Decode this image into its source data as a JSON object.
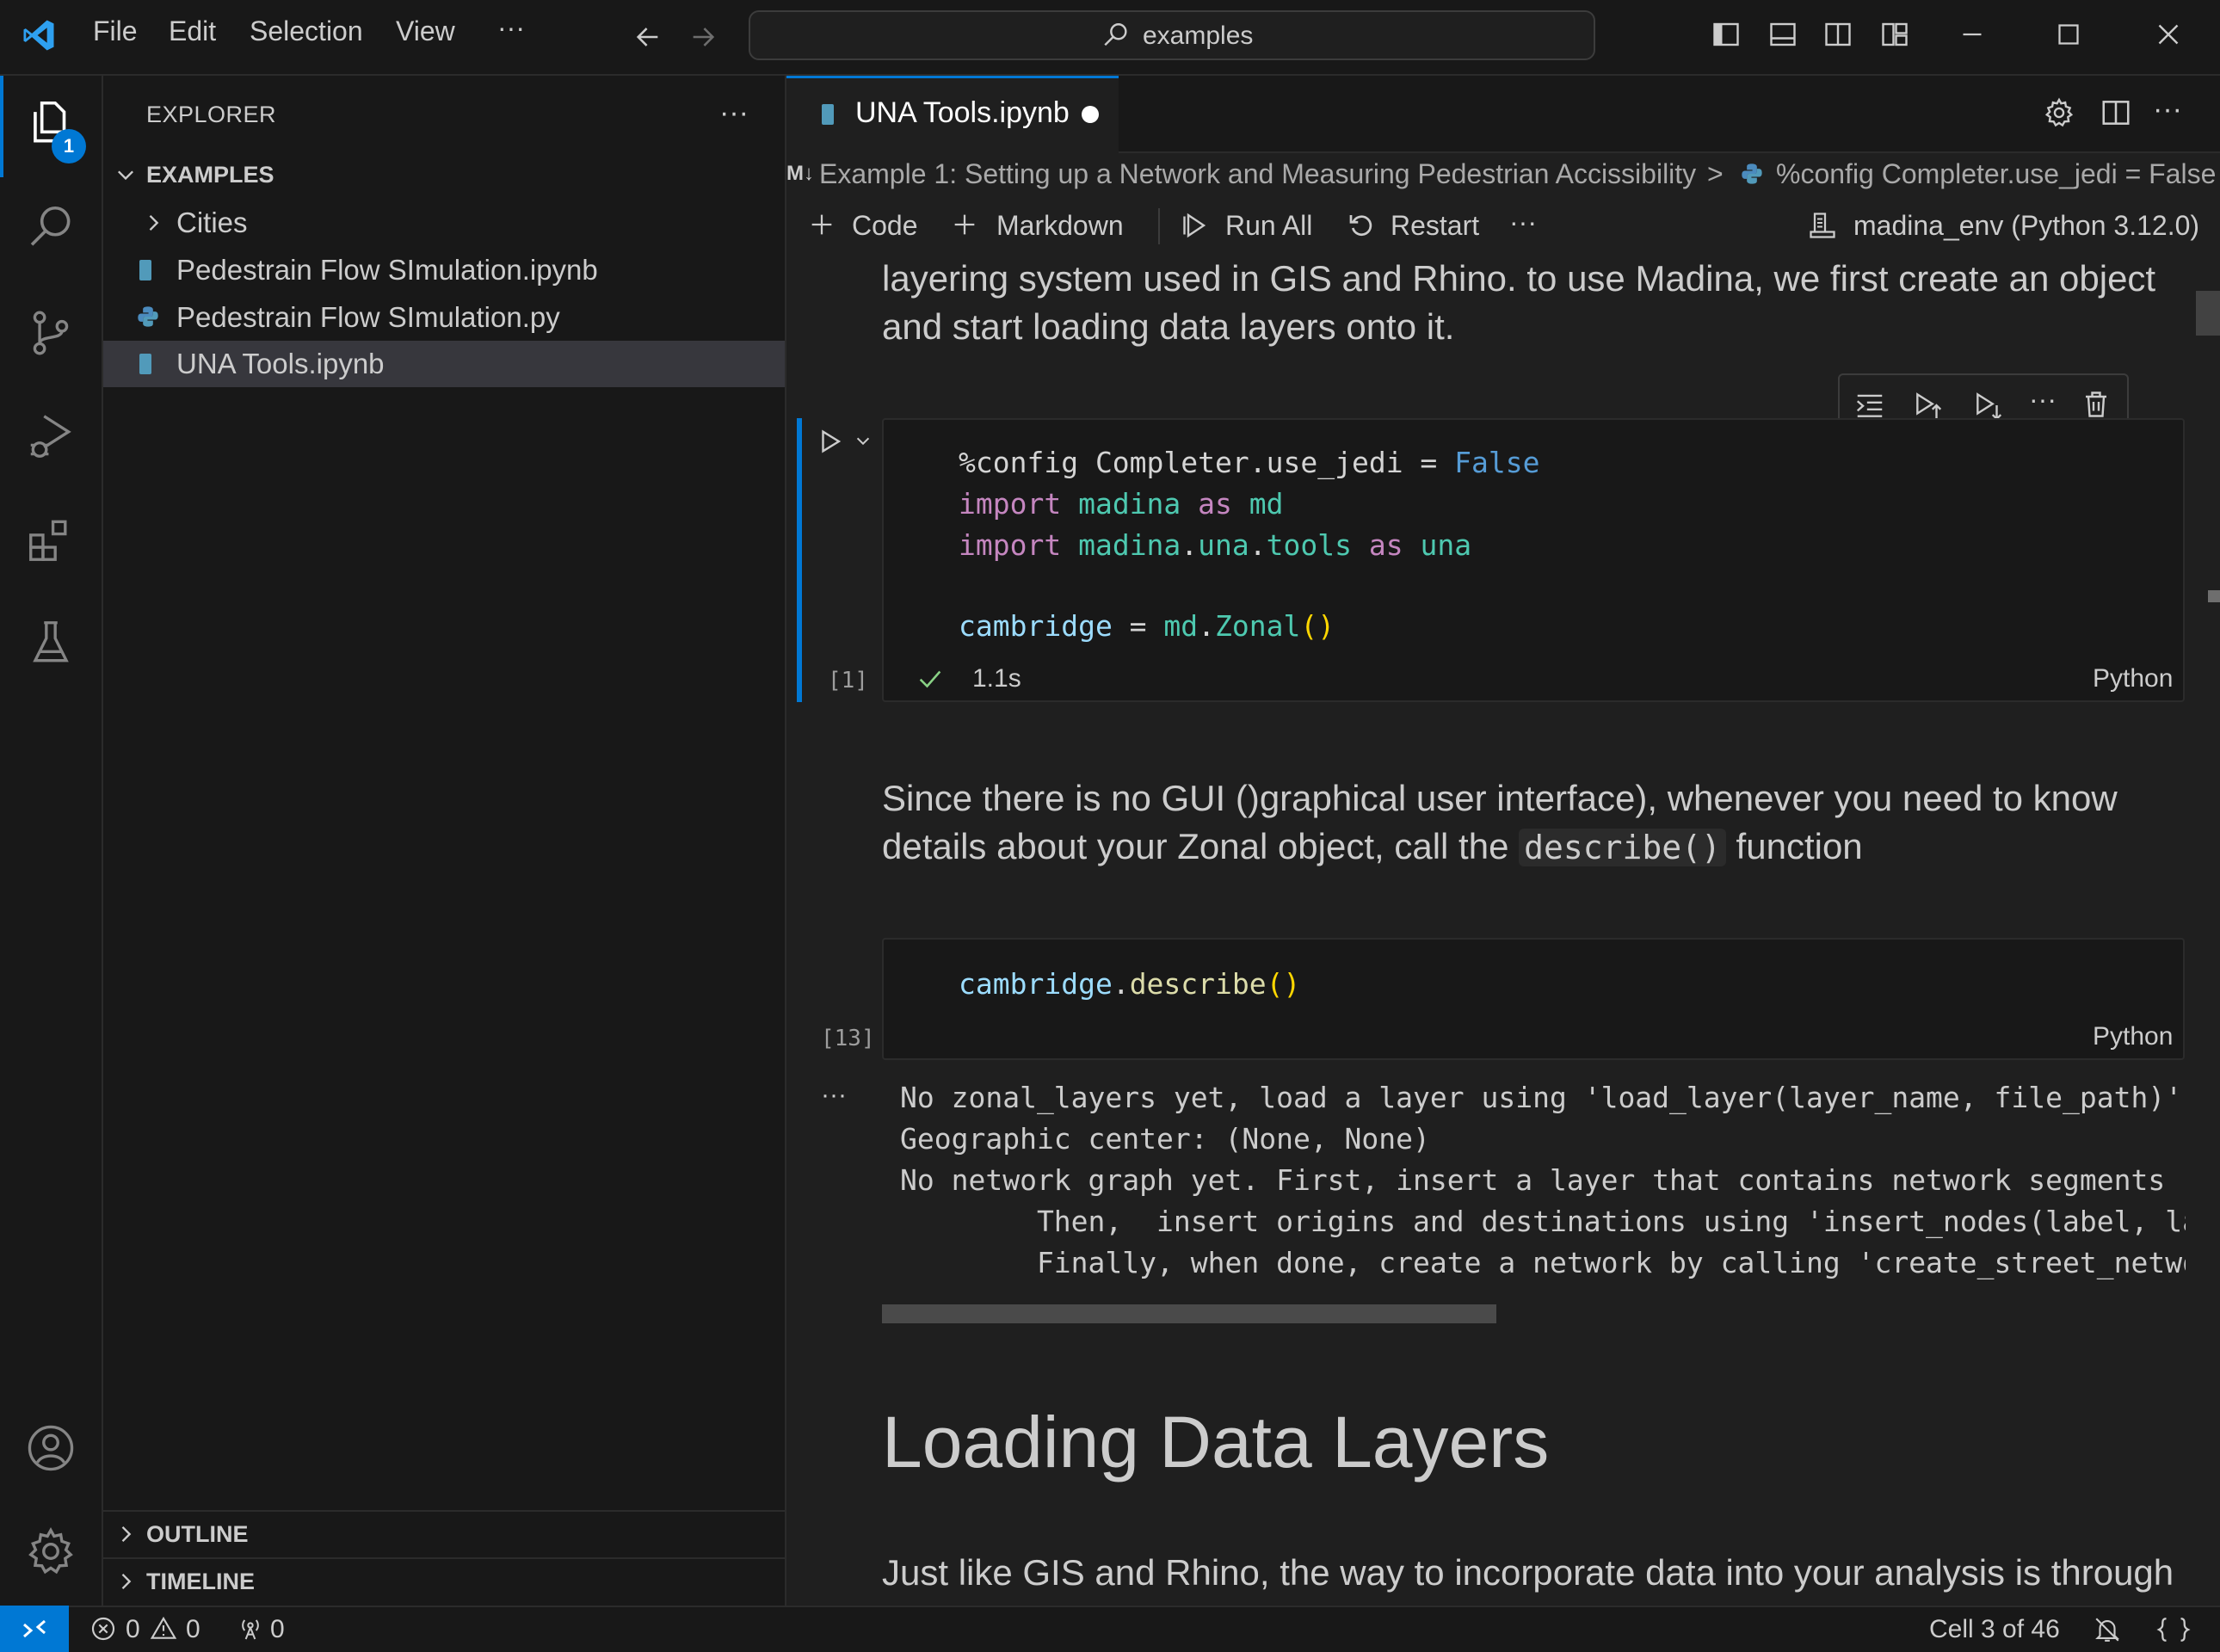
{
  "menu": {
    "file": "File",
    "edit": "Edit",
    "selection": "Selection",
    "view": "View",
    "more": "···"
  },
  "search": {
    "text": "examples"
  },
  "activity": {
    "explorer_badge": "1"
  },
  "sidebar": {
    "title": "EXPLORER",
    "more": "···",
    "workspace": "EXAMPLES",
    "items": [
      {
        "label": "Cities",
        "kind": "folder"
      },
      {
        "label": "Pedestrain Flow SImulation.ipynb",
        "kind": "notebook"
      },
      {
        "label": "Pedestrain Flow SImulation.py",
        "kind": "python"
      },
      {
        "label": "UNA Tools.ipynb",
        "kind": "notebook",
        "selected": true
      }
    ],
    "outline": "OUTLINE",
    "timeline": "TIMELINE"
  },
  "editor": {
    "tab_label": "UNA Tools.ipynb",
    "breadcrumb": {
      "md_marker": "M↓",
      "section": "Example 1: Setting up a Network and Measuring Pedestrian Accissibility",
      "sep": ">",
      "cell": "%config Completer.use_jedi = False"
    },
    "toolbar": {
      "code": "Code",
      "markdown": "Markdown",
      "run_all": "Run All",
      "restart": "Restart",
      "more": "···",
      "kernel": "madina_env (Python 3.12.0)"
    }
  },
  "notebook": {
    "md1": [
      "layering system used in GIS and Rhino. to use Madina, we first create an object",
      "and start loading data layers onto it."
    ],
    "cell1": {
      "exec_count": "[1]",
      "duration": "1.1s",
      "language": "Python",
      "l1_a": "%config Completer.use_jedi",
      "l1_b": " = ",
      "l1_c": "False",
      "l2_a": "import",
      "l2_b": " madina ",
      "l2_c": "as",
      "l2_d": " md",
      "l3_a": "import",
      "l3_b": " madina",
      "l3_c": ".",
      "l3_d": "una",
      "l3_e": ".",
      "l3_f": "tools ",
      "l3_g": "as",
      "l3_h": " una",
      "l5_a": "cambridge",
      "l5_b": " = ",
      "l5_c": "md",
      "l5_d": ".",
      "l5_e": "Zonal",
      "l5_f": "()"
    },
    "md2": {
      "line1": "Since there is no GUI ()graphical user interface), whenever you need to know",
      "line2_a": "details about your Zonal object, call the ",
      "line2_code": "describe()",
      "line2_b": " function"
    },
    "cell2": {
      "exec_count": "[13]",
      "language": "Python",
      "c_a": "cambridge",
      "c_b": ".",
      "c_c": "describe",
      "c_d": "()",
      "output_more": "···",
      "output": [
        "No zonal_layers yet, load a layer using 'load_layer(layer_name, file_path)'",
        "Geographic center: (None, None)",
        "No network graph yet. First, insert a layer that contains network segments (st",
        "        Then,  insert origins and destinations using 'insert_nodes(label, laye",
        "        Finally, when done, create a network by calling 'create_street_network"
      ]
    },
    "heading": "Loading Data Layers",
    "md3": "Just like GIS and Rhino, the way to incorporate data into your analysis is through"
  },
  "status": {
    "errors": "0",
    "warnings": "0",
    "ports": "0",
    "cell_position": "Cell 3 of 46"
  },
  "colors": {
    "accent": "#0078d4",
    "background": "#1f1f1f",
    "sidebar": "#181818",
    "selection": "#37373d",
    "success": "#89d185"
  }
}
